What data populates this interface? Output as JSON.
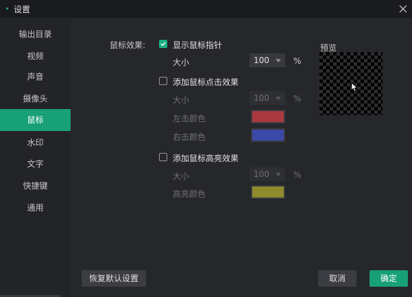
{
  "window": {
    "title": "设置"
  },
  "sidebar": {
    "items": [
      {
        "label": "输出目录"
      },
      {
        "label": "视频"
      },
      {
        "label": "声音"
      },
      {
        "label": "摄像头"
      },
      {
        "label": "鼠标",
        "active": true
      },
      {
        "label": "水印"
      },
      {
        "label": "文字"
      },
      {
        "label": "快捷键"
      },
      {
        "label": "通用"
      }
    ]
  },
  "mouse": {
    "section_label": "鼠标效果:",
    "show_pointer": {
      "label": "显示鼠标指针",
      "checked": true,
      "size_label": "大小",
      "size_value": "100",
      "unit": "%"
    },
    "click_effect": {
      "label": "添加鼠标点击效果",
      "checked": false,
      "size_label": "大小",
      "size_value": "100",
      "unit": "%",
      "left_color_label": "左击颜色",
      "left_color": "#a83a3f",
      "right_color_label": "右击颜色",
      "right_color": "#3b4aa6"
    },
    "highlight_effect": {
      "label": "添加鼠标高亮效果",
      "checked": false,
      "size_label": "大小",
      "size_value": "100",
      "unit": "%",
      "color_label": "高亮颜色",
      "color": "#8f8a2e"
    }
  },
  "preview": {
    "label": "预览"
  },
  "footer": {
    "reset_label": "恢复默认设置",
    "cancel_label": "取消",
    "ok_label": "确定"
  },
  "colors": {
    "accent": "#18a077"
  }
}
